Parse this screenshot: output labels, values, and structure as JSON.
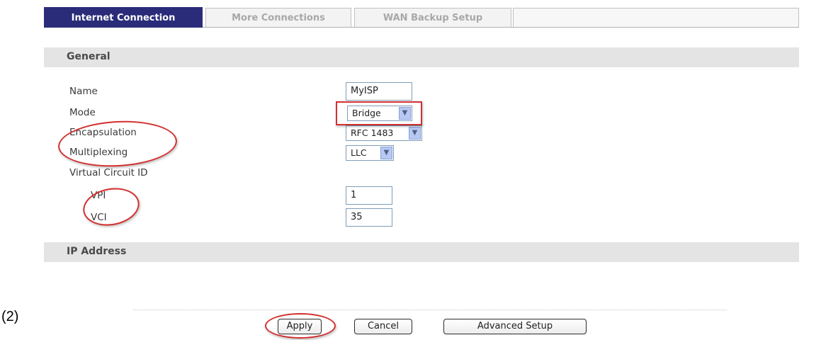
{
  "figure_label": "(2)",
  "tabs": [
    {
      "label": "Internet Connection",
      "active": true
    },
    {
      "label": "More Connections",
      "active": false
    },
    {
      "label": "WAN Backup Setup",
      "active": false
    }
  ],
  "general": {
    "title": "General",
    "name_label": "Name",
    "name_value": "MyISP",
    "mode_label": "Mode",
    "mode_value": "Bridge",
    "encapsulation_label": "Encapsulation",
    "encapsulation_value": "RFC 1483",
    "multiplexing_label": "Multiplexing",
    "multiplexing_value": "LLC",
    "vcid_label": "Virtual Circuit ID",
    "vpi_label": "VPI",
    "vpi_value": "1",
    "vci_label": "VCI",
    "vci_value": "35"
  },
  "ip_address": {
    "title": "IP Address"
  },
  "buttons": {
    "apply": "Apply",
    "cancel": "Cancel",
    "advanced": "Advanced Setup"
  },
  "annotation_color": "#d32f2f",
  "tab_active_color": "#2a2c79",
  "icons": {
    "dropdown": "chevron-down-icon"
  }
}
